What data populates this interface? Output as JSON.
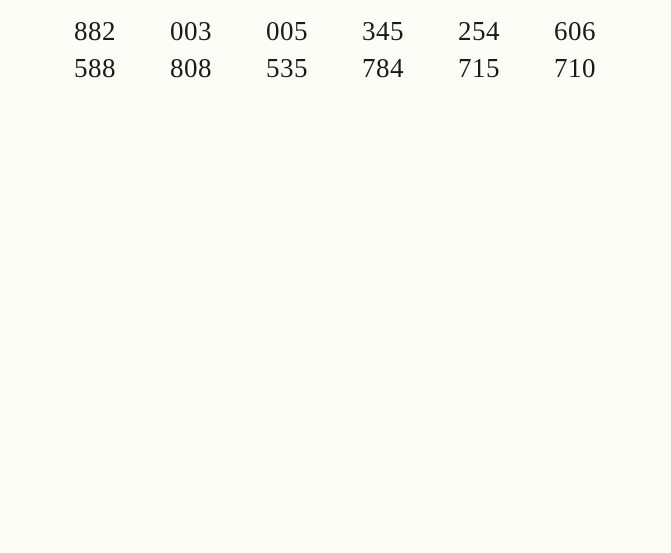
{
  "grid": {
    "rows": [
      [
        "882",
        "003",
        "005",
        "345",
        "254",
        "606"
      ],
      [
        "588",
        "808",
        "535",
        "784",
        "715",
        "710"
      ]
    ]
  }
}
